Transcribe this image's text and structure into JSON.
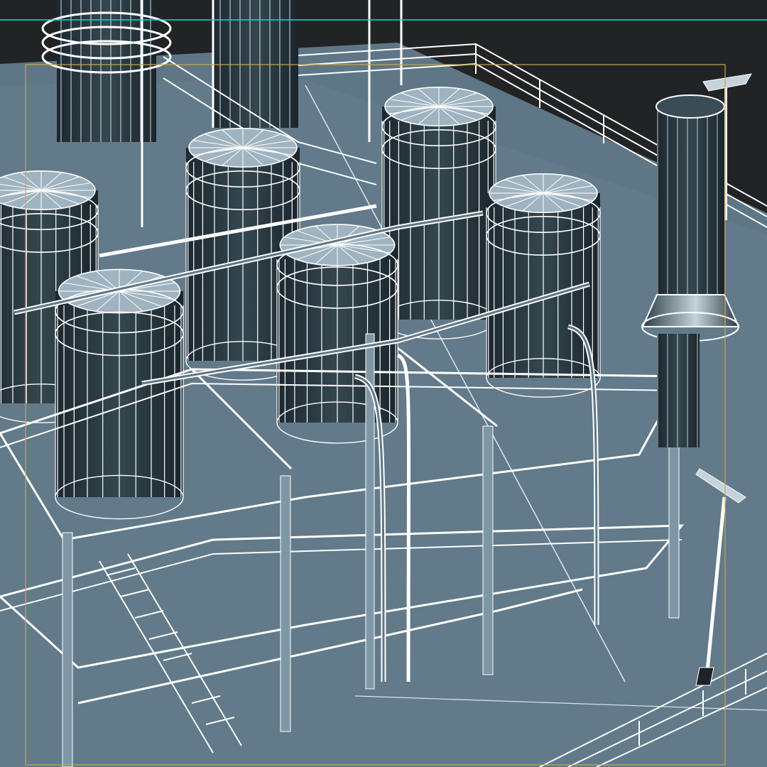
{
  "viewport": {
    "mode": "wireframe-shaded",
    "colors": {
      "background": "#222325",
      "ground": "#5e7685",
      "metal": "#2a3a44",
      "metal_light": "#6e8a9a",
      "wire": "#ffffff",
      "active_axis_line": "#19d3d0",
      "safe_frame": "#c7a84a"
    },
    "objects": [
      {
        "name": "ground-slab",
        "icon": "slab"
      },
      {
        "name": "perimeter-railing",
        "icon": "railing"
      },
      {
        "name": "storage-tank",
        "count": 6,
        "icon": "cylinder-tank"
      },
      {
        "name": "exhaust-stack",
        "icon": "chimney"
      },
      {
        "name": "pipe-rack",
        "icon": "steel-frame"
      },
      {
        "name": "light-pole",
        "count": 2,
        "icon": "lamp-post"
      },
      {
        "name": "distillation-column",
        "icon": "column"
      }
    ]
  }
}
